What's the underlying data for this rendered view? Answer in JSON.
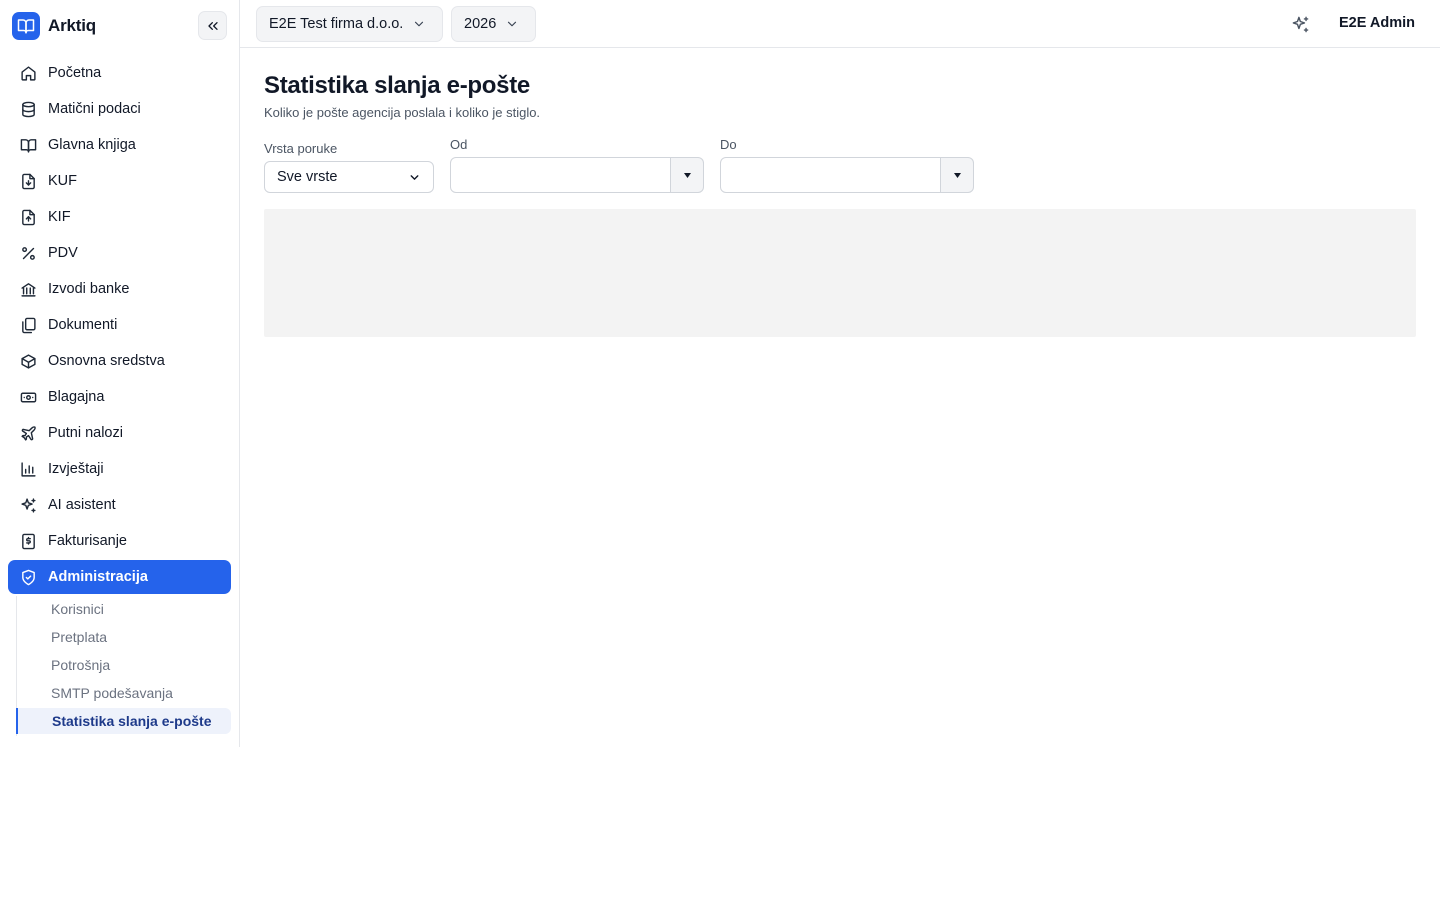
{
  "brand": {
    "name": "Arktiq",
    "logo_icon": "book-open-icon",
    "accent": "#2563eb"
  },
  "sidebar": {
    "collapse_icon": "chevrons-left-icon",
    "items": [
      {
        "label": "Početna",
        "icon": "home-icon"
      },
      {
        "label": "Matični podaci",
        "icon": "database-icon"
      },
      {
        "label": "Glavna knjiga",
        "icon": "book-open-icon"
      },
      {
        "label": "KUF",
        "icon": "file-download-icon"
      },
      {
        "label": "KIF",
        "icon": "file-upload-icon"
      },
      {
        "label": "PDV",
        "icon": "percent-icon"
      },
      {
        "label": "Izvodi banke",
        "icon": "bank-icon"
      },
      {
        "label": "Dokumenti",
        "icon": "files-icon"
      },
      {
        "label": "Osnovna sredstva",
        "icon": "package-icon"
      },
      {
        "label": "Blagajna",
        "icon": "banknote-icon"
      },
      {
        "label": "Putni nalozi",
        "icon": "plane-icon"
      },
      {
        "label": "Izvještaji",
        "icon": "bar-chart-icon"
      },
      {
        "label": "AI asistent",
        "icon": "sparkles-icon"
      },
      {
        "label": "Fakturisanje",
        "icon": "receipt-dollar-icon"
      },
      {
        "label": "Administracija",
        "icon": "shield-check-icon",
        "active": true
      }
    ],
    "sub_items": [
      {
        "label": "Korisnici"
      },
      {
        "label": "Pretplata"
      },
      {
        "label": "Potrošnja"
      },
      {
        "label": "SMTP podešavanja"
      },
      {
        "label": "Statistika slanja e-pošte",
        "active": true
      }
    ]
  },
  "header": {
    "company": "E2E Test firma d.o.o.",
    "year": "2026",
    "ai_icon": "sparkles-icon",
    "user": "E2E Admin"
  },
  "page": {
    "title": "Statistika slanja e-pošte",
    "subtitle": "Koliko je pošte agencija poslala i koliko je stiglo.",
    "filters": {
      "type_label": "Vrsta poruke",
      "type_value": "Sve vrste",
      "from_label": "Od",
      "from_value": "",
      "to_label": "Do",
      "to_value": ""
    }
  }
}
